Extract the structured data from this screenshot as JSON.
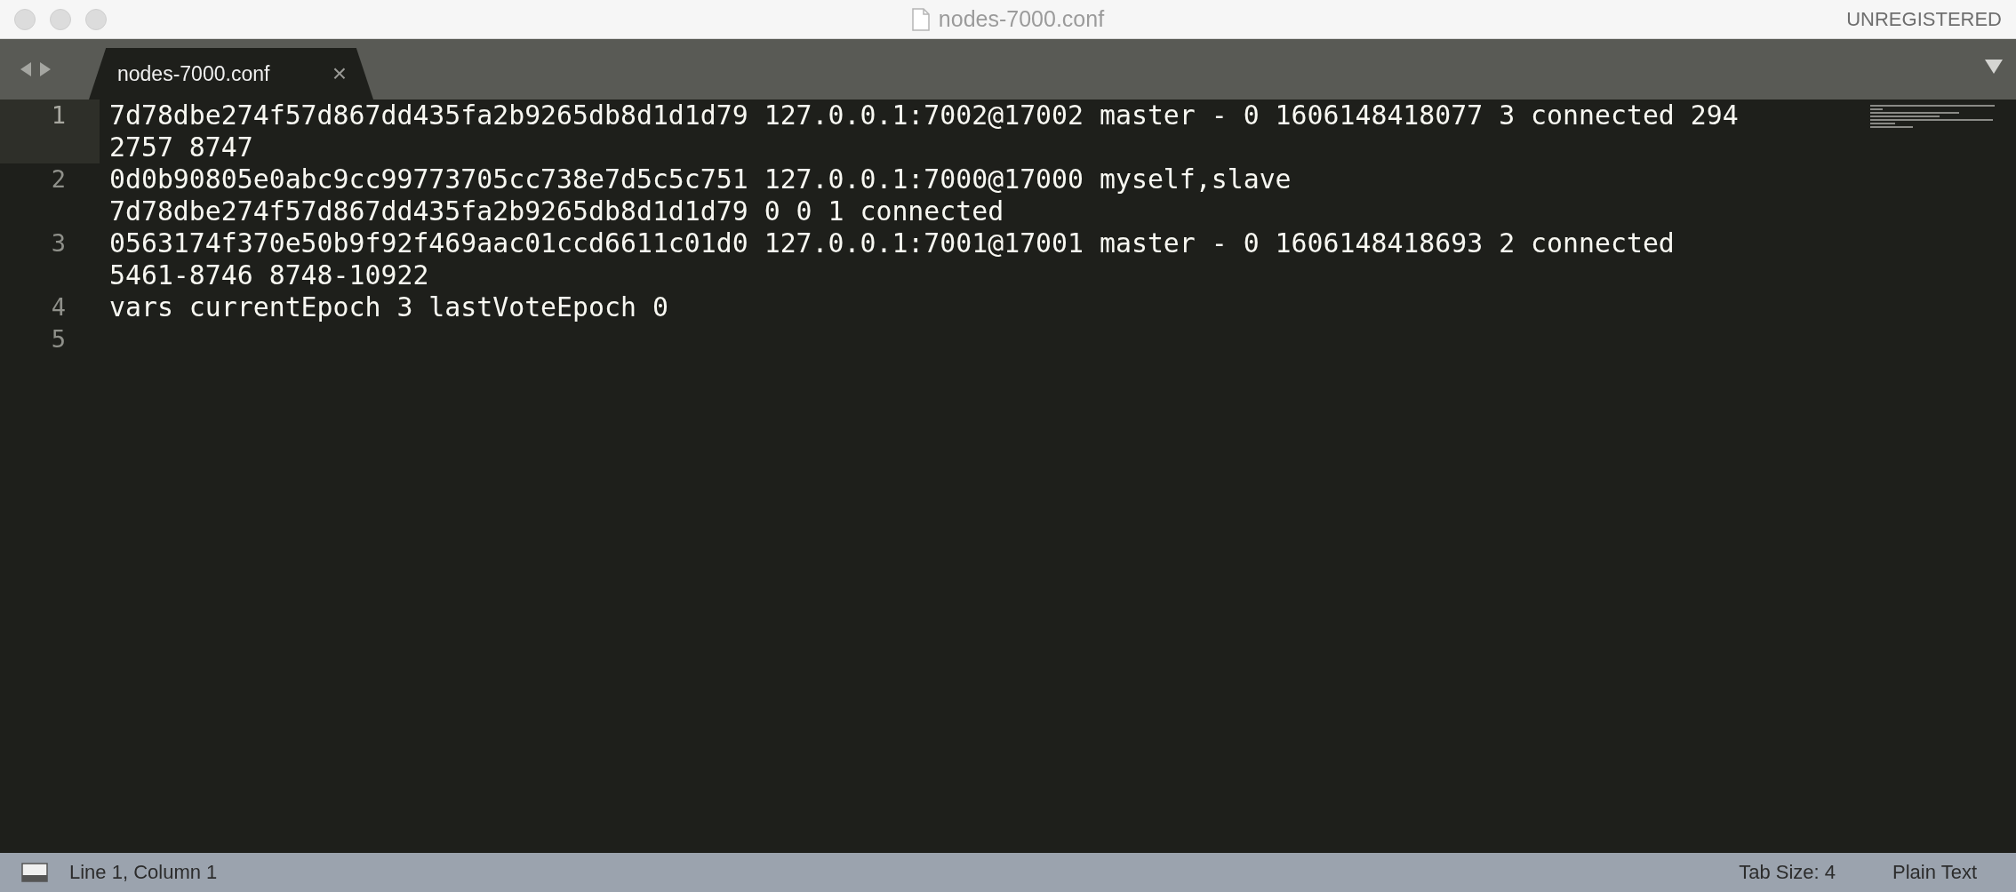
{
  "window": {
    "title": "nodes-7000.conf",
    "license": "UNREGISTERED"
  },
  "tabs": [
    {
      "label": "nodes-7000.conf",
      "selected": true,
      "close": "×"
    }
  ],
  "editor": {
    "lines": [
      {
        "number": "1",
        "current": true,
        "segments": [
          "7d78dbe274f57d867dd435fa2b9265db8d1d1d79 127.0.0.1:7002@17002 master - 0 1606148418077 3 connected 294",
          "2757 8747"
        ]
      },
      {
        "number": "2",
        "current": false,
        "segments": [
          "0d0b90805e0abc9cc99773705cc738e7d5c5c751 127.0.0.1:7000@17000 myself,slave",
          "7d78dbe274f57d867dd435fa2b9265db8d1d1d79 0 0 1 connected"
        ]
      },
      {
        "number": "3",
        "current": false,
        "segments": [
          "0563174f370e50b9f92f469aac01ccd6611c01d0 127.0.0.1:7001@17001 master - 0 1606148418693 2 connected",
          "5461-8746 8748-10922"
        ]
      },
      {
        "number": "4",
        "current": false,
        "segments": [
          "vars currentEpoch 3 lastVoteEpoch 0"
        ]
      },
      {
        "number": "5",
        "current": false
      }
    ]
  },
  "status_bar": {
    "position": "Line 1, Column 1",
    "tab_size": "Tab Size: 4",
    "syntax": "Plain Text"
  }
}
